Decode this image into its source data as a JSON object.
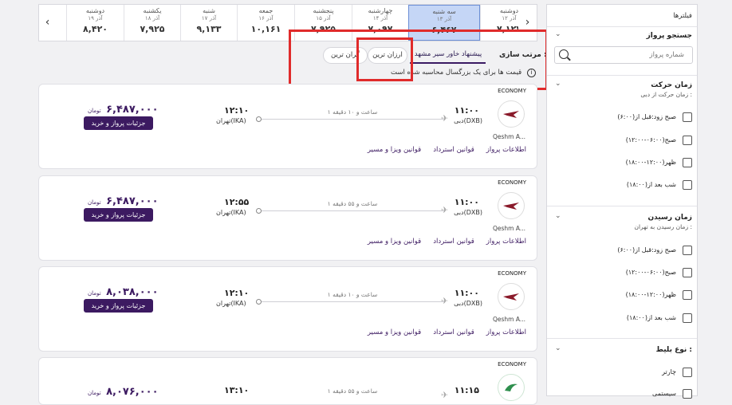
{
  "date_strip": {
    "prev_arrow": "‹",
    "next_arrow": "›",
    "days": [
      {
        "day": "دوشنبه",
        "date": "۱۲ آذر",
        "price": "۷,۱۲۷"
      },
      {
        "day": "سه شنبه",
        "date": "۱۳ آذر",
        "price": "۶,۴۶۷",
        "active": true
      },
      {
        "day": "چهارشنبه",
        "date": "۱۴ آذر",
        "price": "۷,۰۹۷"
      },
      {
        "day": "پنجشنبه",
        "date": "۱۵ آذر",
        "price": "۷,۹۲۵"
      },
      {
        "day": "جمعه",
        "date": "۱۶ آذر",
        "price": "۱۰,۱۶۱"
      },
      {
        "day": "شنبه",
        "date": "۱۷ آذر",
        "price": "۹,۱۳۳"
      },
      {
        "day": "یکشنبه",
        "date": "۱۸ آذر",
        "price": "۷,۹۲۵"
      },
      {
        "day": "دوشنبه",
        "date": "۱۹ آذر",
        "price": "۸,۴۲۰"
      }
    ]
  },
  "sort": {
    "label": "مرتب سازی :",
    "options": [
      "پیشنهاد خاور سیر مشهد",
      "ارزان ترین",
      "گران ترین"
    ],
    "selected": "پیشنهاد خاور سیر مشهد",
    "note": "قیمت ها برای یک بزرگسال محاسبه شده است"
  },
  "flights": [
    {
      "class": "ECONOMY",
      "airline": "Qeshm A...",
      "dep_time": "۱۱:۰۰",
      "dep_place": "دبی(DXB)",
      "arr_time": "۱۲:۱۰",
      "arr_place": "تهران(IKA)",
      "duration": "۱ ساعت و ۱۰ دقیقه",
      "price": "۶,۴۸۷,۰۰۰",
      "currency": "تومان",
      "buy_label": "جزئیات پرواز و خرید",
      "links": [
        "اطلاعات پرواز",
        "قوانین استرداد",
        "قوانین ویزا و مسیر"
      ]
    },
    {
      "class": "ECONOMY",
      "airline": "Qeshm A...",
      "dep_time": "۱۱:۰۰",
      "dep_place": "دبی(DXB)",
      "arr_time": "۱۲:۵۵",
      "arr_place": "تهران(IKA)",
      "duration": "۱ ساعت و ۵۵ دقیقه",
      "price": "۶,۴۸۷,۰۰۰",
      "currency": "تومان",
      "buy_label": "جزئیات پرواز و خرید",
      "links": [
        "اطلاعات پرواز",
        "قوانین استرداد",
        "قوانین ویزا و مسیر"
      ]
    },
    {
      "class": "ECONOMY",
      "airline": "Qeshm A...",
      "dep_time": "۱۱:۰۰",
      "dep_place": "دبی(DXB)",
      "arr_time": "۱۲:۱۰",
      "arr_place": "تهران(IKA)",
      "duration": "۱ ساعت و ۱۰ دقیقه",
      "price": "۸,۰۳۸,۰۰۰",
      "currency": "تومان",
      "buy_label": "جزئیات پرواز و خرید",
      "links": [
        "اطلاعات پرواز",
        "قوانین استرداد",
        "قوانین ویزا و مسیر"
      ]
    },
    {
      "class": "ECONOMY",
      "airline": "",
      "dep_time": "۱۱:۱۵",
      "dep_place": "",
      "arr_time": "۱۳:۱۰",
      "arr_place": "",
      "duration": "۱ ساعت و ۵۵ دقیقه",
      "price": "۸,۰۷۶,۰۰۰",
      "currency": "تومان",
      "buy_label": "",
      "links": []
    }
  ],
  "filters": {
    "title": "فیلترها",
    "search": {
      "heading": "جستجو پرواز",
      "placeholder": "شماره پرواز"
    },
    "departure": {
      "heading": "زمان حرکت",
      "sub": "زمان حرکت از دبی :",
      "options": [
        "صبح زود:قبل از(۶:۰۰)",
        "صبح(۰۶:۰۰-۱۲:۰۰)",
        "ظهر(۱۲:۰۰-۱۸:۰۰)",
        "شب بعد از(۱۸:۰۰)"
      ]
    },
    "arrival": {
      "heading": "زمان رسیدن",
      "sub": "زمان رسیدن به تهران :",
      "options": [
        "صبح زود:قبل از(۶:۰۰)",
        "صبح(۰۶:۰۰-۱۲:۰۰)",
        "ظهر(۱۲:۰۰-۱۸:۰۰)",
        "شب بعد از(۱۸:۰۰)"
      ]
    },
    "ticket_type": {
      "heading": "نوع بلیط :",
      "options": [
        "چارتر",
        "سیستمی"
      ]
    }
  },
  "colors": {
    "accent": "#3c1a61",
    "active_date": "#c5d6f6",
    "highlight": "#e02b2b"
  }
}
